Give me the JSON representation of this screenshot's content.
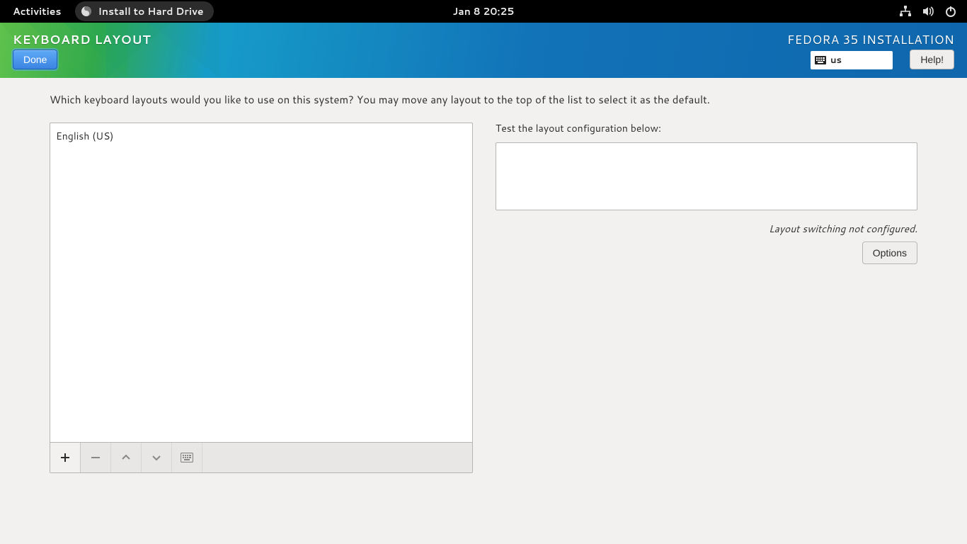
{
  "topbar": {
    "activities": "Activities",
    "app_pill": "Install to Hard Drive",
    "clock": "Jan 8  20:25"
  },
  "header": {
    "title": "KEYBOARD LAYOUT",
    "done": "Done",
    "product": "FEDORA 35 INSTALLATION",
    "lang_indicator": "us",
    "help": "Help!"
  },
  "main": {
    "prompt": "Which keyboard layouts would you like to use on this system?  You may move any layout to the top of the list to select it as the default.",
    "layouts": [
      "English (US)"
    ],
    "test_label": "Test the layout configuration below:",
    "test_value": "",
    "switch_msg": "Layout switching not configured.",
    "options": "Options"
  }
}
